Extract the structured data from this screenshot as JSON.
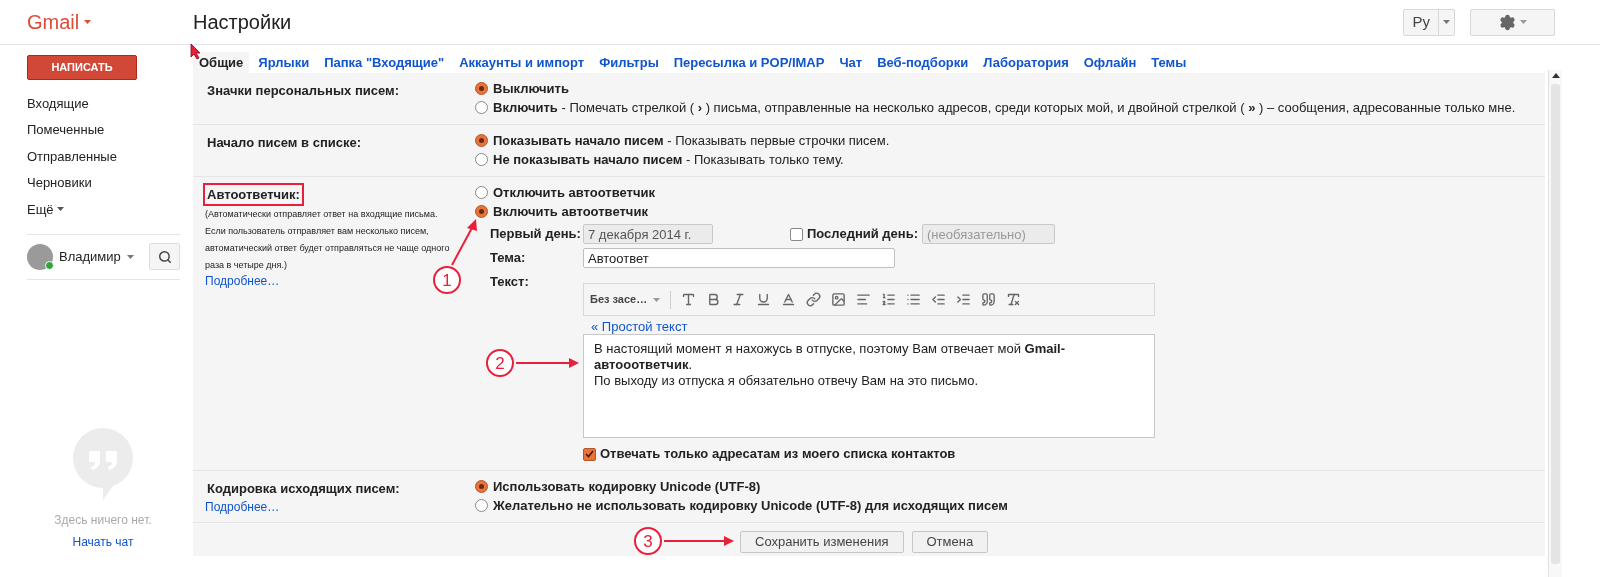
{
  "header": {
    "logo": "Gmail",
    "title": "Настройки",
    "language_button": "Ру"
  },
  "sidebar": {
    "compose": "НАПИСАТЬ",
    "items": [
      {
        "label": "Входящие",
        "selected": false,
        "kind": "folder"
      },
      {
        "label": "Помеченные",
        "selected": false,
        "kind": "folder"
      },
      {
        "label": "Отправленные",
        "selected": false,
        "kind": "folder"
      },
      {
        "label": "Черновики",
        "selected": false,
        "kind": "folder"
      },
      {
        "label": "Ещё",
        "selected": false,
        "kind": "more"
      }
    ],
    "user": {
      "name": "Владимир",
      "online": true
    },
    "chat": {
      "empty_text": "Здесь ничего нет.",
      "link": "Начать чат"
    }
  },
  "tabs": [
    {
      "label": "Общие",
      "selected": true
    },
    {
      "label": "Ярлыки",
      "selected": false
    },
    {
      "label": "Папка \"Входящие\"",
      "selected": false
    },
    {
      "label": "Аккаунты и импорт",
      "selected": false
    },
    {
      "label": "Фильтры",
      "selected": false
    },
    {
      "label": "Пересылка и POP/IMAP",
      "selected": false
    },
    {
      "label": "Чат",
      "selected": false
    },
    {
      "label": "Веб-подборки",
      "selected": false
    },
    {
      "label": "Лаборатория",
      "selected": false
    },
    {
      "label": "Офлайн",
      "selected": false
    },
    {
      "label": "Темы",
      "selected": false
    }
  ],
  "sections": [
    {
      "kind": "radio",
      "label": "Значки персональных писем:",
      "options": [
        {
          "title": "Выключить",
          "selected": true
        },
        {
          "title": "Включить",
          "detail": "- Помечать стрелкой ( **›** ) письма, отправленные на несколько адресов, среди которых мой, и двойной стрелкой ( **»** ) – сообщения, адресованные только мне.",
          "selected": false
        }
      ]
    },
    {
      "kind": "radio",
      "label": "Начало писем в списке:",
      "options": [
        {
          "title": "Показывать начало писем",
          "detail": "- Показывать первые строчки писем.",
          "selected": true
        },
        {
          "title": "Не показывать начало писем",
          "detail": "- Показывать только тему.",
          "selected": false
        }
      ]
    },
    {
      "kind": "autoresponder",
      "label": "Автоответчик:",
      "highlighted": true,
      "description": "(Автоматически отправляет ответ на входящие письма. Если пользователь отправляет вам несколько писем, автоматический ответ будет отправляться не чаще одного раза в четыре дня.)",
      "link": "Подробнее…",
      "options": [
        {
          "title": "Отключить автоответчик",
          "selected": false
        },
        {
          "title": "Включить автоответчик",
          "selected": true
        }
      ],
      "first_day": {
        "label": "Первый день:",
        "value": "7 декабря 2014 г.",
        "disabled": true
      },
      "last_day": {
        "label": "Последний день:",
        "checked": false,
        "placeholder": "(необязательно)",
        "disabled": true
      },
      "subject": {
        "label": "Тема:",
        "value": "Автоответ"
      },
      "body": {
        "label": "Текст:",
        "font": "Без засе…",
        "plain_text_link": "« Простой текст",
        "paragraphs": [
          "В настоящий момент я нахожусь в отпуске, поэтому Вам отвечает мой **Gmail-автооответчик**.",
          "По выходу из отпуска я обязательно отвечу Вам на это письмо."
        ]
      },
      "contacts_only": {
        "label": "Отвечать только адресатам из моего списка контактов",
        "checked": true
      }
    },
    {
      "kind": "radio",
      "label": "Кодировка исходящих писем:",
      "link": "Подробнее…",
      "options": [
        {
          "title": "Использовать кодировку Unicode (UTF-8)",
          "selected": true
        },
        {
          "title": "Желательно не использовать кодировку Unicode (UTF-8) для исходящих писем",
          "selected": false
        }
      ]
    }
  ],
  "buttons": [
    {
      "label": "Сохранить изменения"
    },
    {
      "label": "Отмена"
    }
  ],
  "annotations": [
    {
      "number": "1"
    },
    {
      "number": "2"
    },
    {
      "number": "3"
    }
  ]
}
